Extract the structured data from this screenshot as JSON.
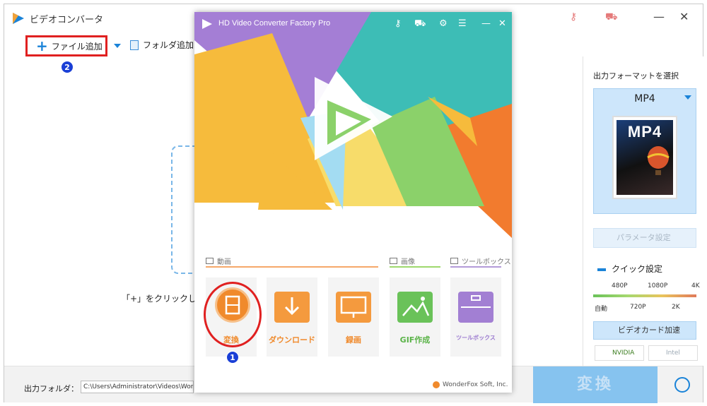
{
  "app": {
    "title": "ビデオコンバータ"
  },
  "toolbar": {
    "add_file_label": "ファイル追加",
    "add_folder_label": "フォルダ追加"
  },
  "steps": {
    "add_file_badge": "2",
    "convert_badge": "1"
  },
  "main": {
    "drop_hint": "「+」をクリックし"
  },
  "right_panel": {
    "title": "出力フォーマットを選択",
    "format_name": "MP4",
    "format_image_label": "MP4",
    "param_button": "パラメータ設定",
    "quick_label": "クイック設定",
    "quick_top": [
      "480P",
      "1080P",
      "4K"
    ],
    "quick_bottom": [
      "自動",
      "720P",
      "2K"
    ],
    "gpu_label": "ビデオカード加速",
    "vendor_nvidia": "NVIDIA",
    "vendor_intel": "Intel"
  },
  "bottom": {
    "out_label": "出力フォルダ：",
    "out_path": "C:\\Users\\Administrator\\Videos\\Wonde",
    "convert_label": "変換"
  },
  "popup": {
    "title": "HD Video Converter Factory Pro",
    "cat_video": "動画",
    "cat_image": "画像",
    "cat_toolbox": "ツールボックス",
    "tiles": [
      "変換",
      "ダウンロード",
      "録画",
      "GIF作成",
      "ツールボックス"
    ],
    "footer": "WonderFox Soft, Inc."
  },
  "colors": {
    "accent": "#1a83d8",
    "highlight": "#e02020",
    "convert_orange": "#f08a2c"
  }
}
